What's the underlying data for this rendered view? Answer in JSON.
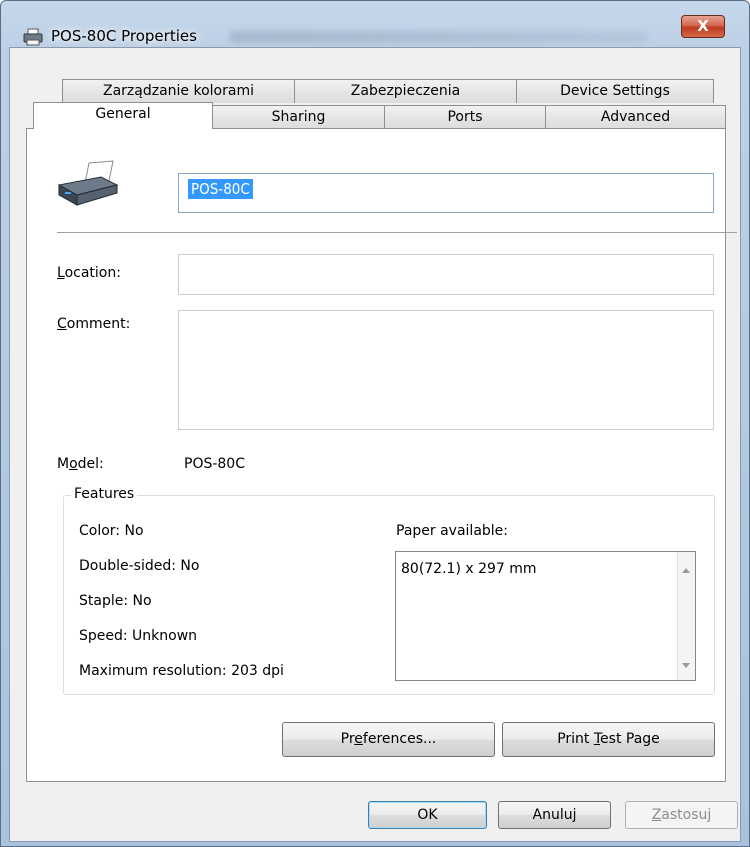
{
  "window": {
    "title": "POS-80C Properties",
    "close_label": "X"
  },
  "tabs_row1": [
    {
      "label": "Zarządzanie kolorami"
    },
    {
      "label": "Zabezpieczenia"
    },
    {
      "label": "Device Settings"
    }
  ],
  "tabs_row2": [
    {
      "label": "General"
    },
    {
      "label": "Sharing"
    },
    {
      "label": "Ports"
    },
    {
      "label": "Advanced"
    }
  ],
  "general": {
    "printer_name": "POS-80C",
    "location_label_first": "L",
    "location_label_rest": "ocation:",
    "location_value": "",
    "comment_label_first": "C",
    "comment_label_rest": "omment:",
    "comment_value": "",
    "model_label_pre": "M",
    "model_label_u": "o",
    "model_label_post": "del:",
    "model_value": "POS-80C"
  },
  "features": {
    "title": "Features",
    "color": "Color: No",
    "double_sided": "Double-sided: No",
    "staple": "Staple: No",
    "speed": "Speed: Unknown",
    "max_resolution": "Maximum resolution: 203 dpi",
    "paper_label": "Paper available:",
    "paper_items": [
      "80(72.1) x 297 mm"
    ]
  },
  "buttons": {
    "preferences_pre": "Pr",
    "preferences_u": "e",
    "preferences_post": "ferences...",
    "print_test_pre": "Print ",
    "print_test_u": "T",
    "print_test_post": "est Page",
    "ok": "OK",
    "cancel": "Anuluj",
    "apply_u": "Z",
    "apply_post": "astosuj"
  },
  "colors": {
    "selection": "#3399ff",
    "close_button": "#c0391f"
  }
}
